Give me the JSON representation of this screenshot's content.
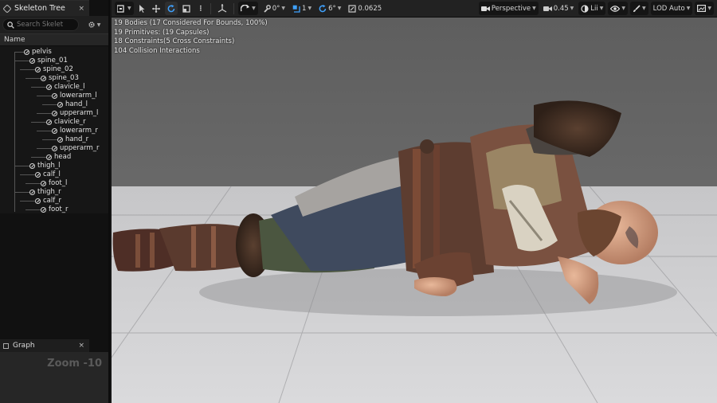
{
  "skeleton_tree": {
    "tab_title": "Skeleton Tree",
    "close_glyph": "×",
    "search_placeholder": "Search Skelet",
    "column_header": "Name",
    "bones": [
      {
        "name": "pelvis",
        "depth": 0
      },
      {
        "name": "spine_01",
        "depth": 1
      },
      {
        "name": "spine_02",
        "depth": 2
      },
      {
        "name": "spine_03",
        "depth": 3
      },
      {
        "name": "clavicle_l",
        "depth": 4
      },
      {
        "name": "lowerarm_l",
        "depth": 5
      },
      {
        "name": "hand_l",
        "depth": 6
      },
      {
        "name": "upperarm_l",
        "depth": 5
      },
      {
        "name": "clavicle_r",
        "depth": 4
      },
      {
        "name": "lowerarm_r",
        "depth": 5
      },
      {
        "name": "hand_r",
        "depth": 6
      },
      {
        "name": "upperarm_r",
        "depth": 5
      },
      {
        "name": "head",
        "depth": 4
      },
      {
        "name": "thigh_l",
        "depth": 1
      },
      {
        "name": "calf_l",
        "depth": 2
      },
      {
        "name": "foot_l",
        "depth": 3
      },
      {
        "name": "thigh_r",
        "depth": 1
      },
      {
        "name": "calf_r",
        "depth": 2
      },
      {
        "name": "foot_r",
        "depth": 3
      }
    ]
  },
  "graph": {
    "tab_title": "Graph",
    "close_glyph": "×",
    "zoom_label": "Zoom -10"
  },
  "toolbar": {
    "rotate_value": "0°",
    "scale_value": "1",
    "angle_value": "6°",
    "grid_value": "0.0625",
    "view_mode": "Perspective",
    "speed_value": "0.45",
    "lighting": "Lii",
    "lod": "LOD Auto"
  },
  "stats": {
    "bodies": "19 Bodies (17 Considered For Bounds, 100%)",
    "primitives": "19 Primitives: (19 Capsules)",
    "constraints": "18 Constraints(5 Cross Constraints)",
    "interactions": "104 Collision Interactions"
  },
  "icons": [
    "bone-icon",
    "search-icon",
    "gear-icon",
    "select-arrow-icon",
    "move-icon",
    "rotate-icon",
    "scale-icon",
    "camera-icon",
    "eye-icon",
    "graph-icon"
  ],
  "colors": {
    "accent_blue": "#3fa2ff",
    "toolbar_bg": "#222222",
    "panel_bg": "#1a1a1a",
    "viewport_sky": "#6b6b6b",
    "floor": "#d2d2d4"
  }
}
